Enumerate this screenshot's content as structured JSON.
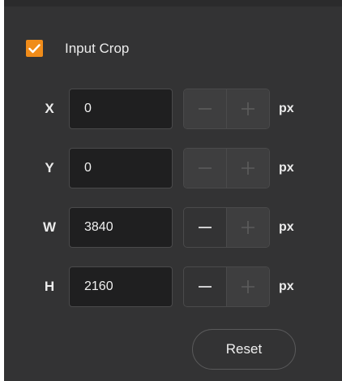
{
  "crop": {
    "enabled": true,
    "label": "Input Crop"
  },
  "fields": [
    {
      "label": "X",
      "value": "0",
      "unit": "px",
      "minus_enabled": false,
      "plus_enabled": false
    },
    {
      "label": "Y",
      "value": "0",
      "unit": "px",
      "minus_enabled": false,
      "plus_enabled": false
    },
    {
      "label": "W",
      "value": "3840",
      "unit": "px",
      "minus_enabled": true,
      "plus_enabled": false
    },
    {
      "label": "H",
      "value": "2160",
      "unit": "px",
      "minus_enabled": true,
      "plus_enabled": false
    }
  ],
  "reset_label": "Reset",
  "colors": {
    "panel_bg": "#333334",
    "accent": "#f08c1a",
    "input_bg": "#1f1f20",
    "enabled_icon": "#e6e6e6",
    "disabled_icon": "#5c5c5d"
  }
}
